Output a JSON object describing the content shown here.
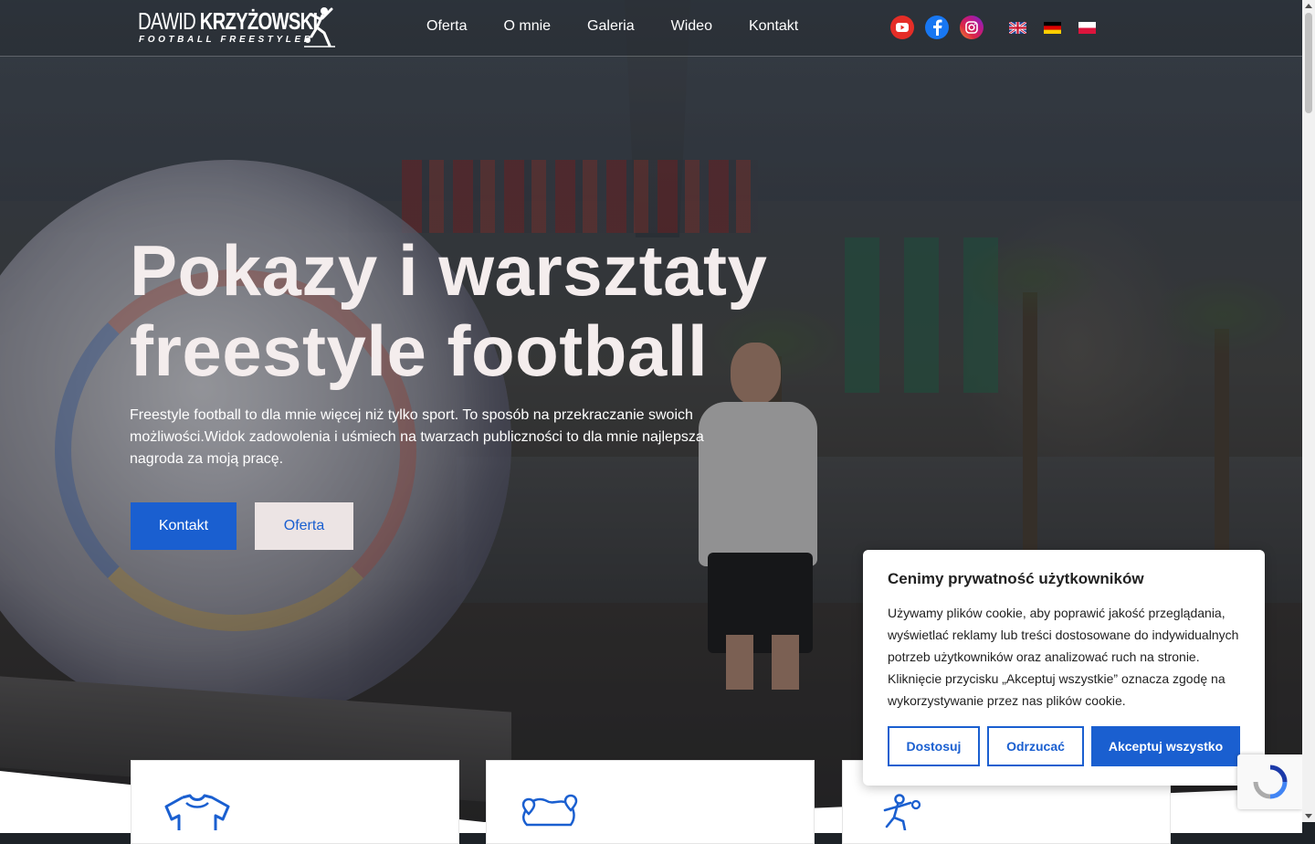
{
  "header": {
    "logo": {
      "first": "DAWID ",
      "last": "KRZYŻOWSKI",
      "tagline": "FOOTBALL FREESTYLER"
    },
    "nav": [
      "Oferta",
      "O mnie",
      "Galeria",
      "Wideo",
      "Kontakt"
    ],
    "social": [
      {
        "icon": "youtube-icon",
        "color": "#e52d27"
      },
      {
        "icon": "facebook-icon",
        "color": "#1877f2"
      },
      {
        "icon": "instagram-icon",
        "color": "#d6249f"
      }
    ],
    "languages": [
      "english-flag-icon",
      "german-flag-icon",
      "polish-flag-icon"
    ]
  },
  "hero": {
    "title_line1": "Pokazy i warsztaty",
    "title_line2": "freestyle football",
    "lead": "Freestyle football to dla mnie więcej niż tylko sport. To sposób na przekraczanie swoich możliwości.Widok zadowolenia i uśmiech na twarzach publiczności to dla mnie najlepsza nagroda za moją pracę.",
    "btn_kontakt": "Kontakt",
    "btn_oferta": "Oferta"
  },
  "cards": [
    "jersey-icon",
    "world-map-pin-icon",
    "freestyler-icon"
  ],
  "cookie": {
    "title": "Cenimy prywatność użytkowników",
    "text": "Używamy plików cookie, aby poprawić jakość przeglądania, wyświetlać reklamy lub treści dostosowane do indywidualnych potrzeb użytkowników oraz analizować ruch na stronie. Kliknięcie przycisku „Akceptuj wszystkie” oznacza zgodę na wykorzystywanie przez nas plików cookie.",
    "btn_customize": "Dostosuj",
    "btn_reject": "Odrzucać",
    "btn_accept": "Akceptuj wszystko"
  },
  "colors": {
    "accent": "#1a5fd0"
  }
}
